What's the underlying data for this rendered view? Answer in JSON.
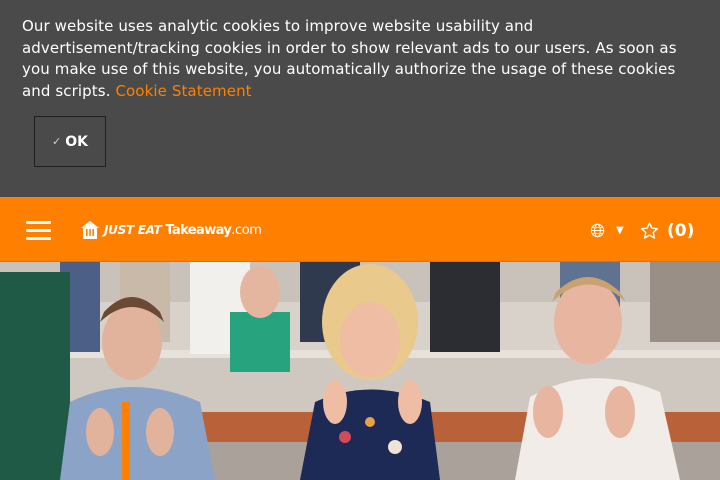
{
  "cookie_banner": {
    "text": "Our website uses analytic cookies to improve website usability and advertisement/tracking cookies in order to show relevant ads to our users. As soon as you make use of this website, you automatically authorize the usage of these cookies and scripts. ",
    "link_label": "Cookie Statement",
    "ok_label": "OK",
    "ok_icon": "check-icon"
  },
  "header": {
    "menu_icon": "hamburger-menu-icon",
    "logo": {
      "part1": "JUST EAT",
      "part2": "Takeaway",
      "part3": ".com"
    },
    "language_icon": "globe-icon",
    "favorites_icon": "star-icon",
    "favorites_count": "(0)"
  },
  "colors": {
    "brand_orange": "#ff8000",
    "banner_bg": "#4a4a4a",
    "link": "#ff8000"
  },
  "hero": {
    "image": "photo-of-smiling-people-clapping-in-auditorium"
  }
}
